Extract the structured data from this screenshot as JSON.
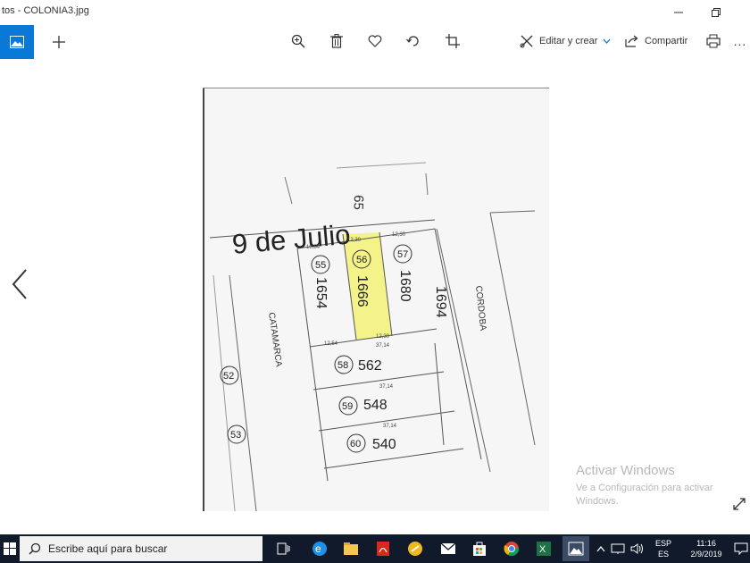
{
  "window": {
    "title": "tos - COLONIA3.jpg"
  },
  "toolbar": {
    "edit_label": "Editar y crear",
    "share_label": "Compartir",
    "more_label": "..."
  },
  "map": {
    "street_top": "9 de Julio",
    "street_left": "CATAMARCA",
    "street_right": "CORDOBA",
    "lot_top_number": "65",
    "lots": [
      {
        "lot": "55",
        "number": "1654"
      },
      {
        "lot": "56",
        "number": "1666"
      },
      {
        "lot": "57",
        "number": "1680"
      },
      {
        "lot": "58",
        "number": "562"
      },
      {
        "lot": "59",
        "number": "548"
      },
      {
        "lot": "60",
        "number": "540"
      },
      {
        "lot": "52",
        "number": ""
      },
      {
        "lot": "53",
        "number": ""
      }
    ],
    "right_number": "1694",
    "measures": {
      "m1": "10,54",
      "m2": "12,30",
      "m3": "12,30",
      "m4": "12,54",
      "m5": "37,14",
      "m6": "12,30",
      "m7": "37,14",
      "m8": "37,14"
    }
  },
  "watermark": {
    "line1": "Activar Windows",
    "line2": "Ve a Configuración para activar Windows."
  },
  "taskbar": {
    "search_placeholder": "Escribe aquí para buscar",
    "lang1": "ESP",
    "lang2": "ES",
    "time": "11:16",
    "date": "2/9/2019"
  },
  "colors": {
    "accent": "#0a78d7",
    "highlight": "#f3f38a",
    "taskbar": "#101a2b"
  }
}
